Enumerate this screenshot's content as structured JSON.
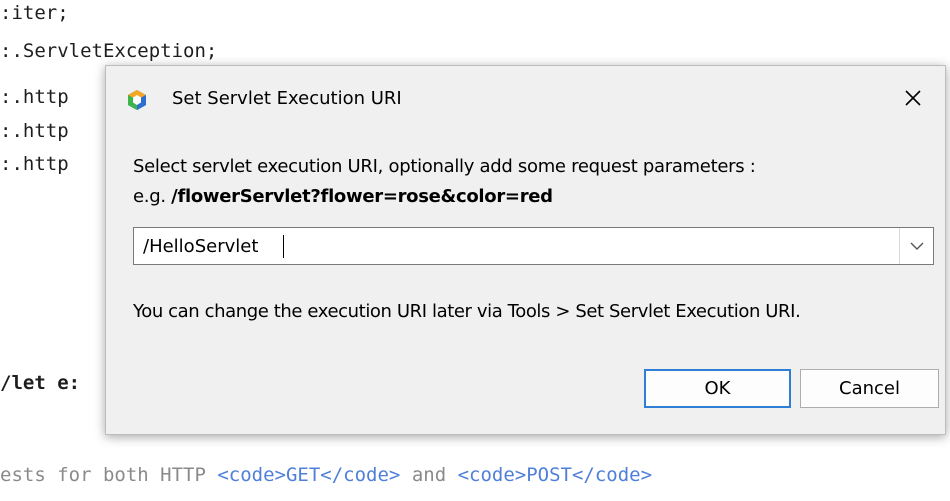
{
  "editor": {
    "lines": [
      ":iter;",
      ":.ServletException;",
      ":.http",
      ":.http",
      ":.http",
      "/let e:"
    ],
    "bottom_line": {
      "prefix": "ests for both HTTP ",
      "tag1": "<code>GET</code>",
      "middle": " and ",
      "tag2": "<code>POST</code>"
    }
  },
  "dialog": {
    "title": "Set Servlet Execution URI",
    "description": "Select servlet execution URI, optionally add some request parameters :",
    "example_prefix": "e.g. ",
    "example_value": "/flowerServlet?flower=rose&color=red",
    "uri_value": "/HelloServlet",
    "hint": "You can change the execution URI later via Tools > Set Servlet Execution URI.",
    "ok_label": "OK",
    "cancel_label": "Cancel",
    "icons": {
      "app": "netbeans-cube-icon",
      "close": "close-icon",
      "dropdown": "chevron-down-icon"
    }
  }
}
